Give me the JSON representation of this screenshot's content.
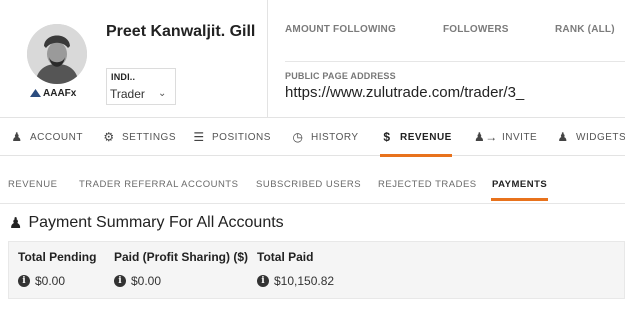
{
  "profile": {
    "name": "Preet Kanwaljit. Gill",
    "broker_logo": "AAAFx",
    "country": "INDI..",
    "role": "Trader"
  },
  "stats": {
    "amount_following_label": "AMOUNT FOLLOWING",
    "followers_label": "FOLLOWERS",
    "rank_label": "RANK (ALL)",
    "public_address_label": "PUBLIC PAGE ADDRESS",
    "public_address": "https://www.zulutrade.com/trader/3_"
  },
  "main_tabs": [
    {
      "label": "ACCOUNT",
      "icon": "user-icon"
    },
    {
      "label": "SETTINGS",
      "icon": "gear-icon"
    },
    {
      "label": "POSITIONS",
      "icon": "list-icon"
    },
    {
      "label": "HISTORY",
      "icon": "clock-icon"
    },
    {
      "label": "REVENUE",
      "icon": "dollar-icon",
      "active": true
    },
    {
      "label": "INVITE",
      "icon": "invite-users-icon"
    },
    {
      "label": "WIDGETS",
      "icon": "user-icon"
    }
  ],
  "sub_tabs": [
    {
      "label": "REVENUE"
    },
    {
      "label": "TRADER REFERRAL ACCOUNTS"
    },
    {
      "label": "SUBSCRIBED USERS"
    },
    {
      "label": "REJECTED TRADES"
    },
    {
      "label": "PAYMENTS",
      "active": true
    }
  ],
  "payment_summary": {
    "title": "Payment Summary For All Accounts",
    "columns": [
      {
        "header": "Total Pending",
        "value": "$0.00"
      },
      {
        "header": "Paid (Profit Sharing) ($)",
        "value": "$0.00"
      },
      {
        "header": "Total Paid",
        "value": "$10,150.82"
      }
    ]
  },
  "colors": {
    "accent": "#e8721c",
    "text": "#222222",
    "muted": "#777777"
  }
}
